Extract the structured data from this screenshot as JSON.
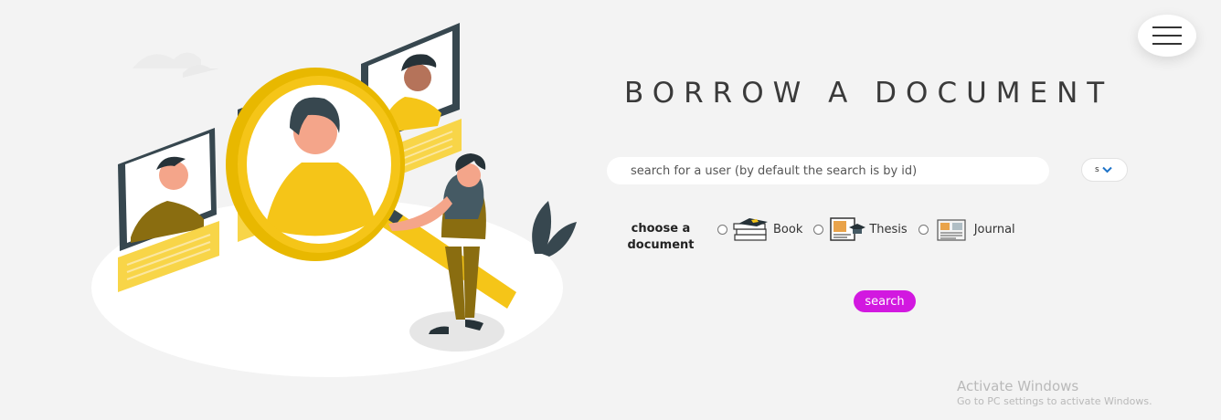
{
  "page": {
    "title": "BORROW A DOCUMENT"
  },
  "search": {
    "placeholder": "search for a user (by default the search is by id)",
    "select_value": "s"
  },
  "document_choice": {
    "label": "choose a document",
    "options": [
      {
        "label": "Book",
        "icon": "book-stack-icon"
      },
      {
        "label": "Thesis",
        "icon": "thesis-icon"
      },
      {
        "label": "Journal",
        "icon": "journal-icon"
      }
    ]
  },
  "actions": {
    "search_label": "search"
  },
  "watermark": {
    "line1": "Activate Windows",
    "line2": "Go to PC settings to activate Windows."
  },
  "colors": {
    "accent": "#d218e0",
    "background": "#f3f3f3",
    "illustration_yellow": "#f5c518"
  }
}
